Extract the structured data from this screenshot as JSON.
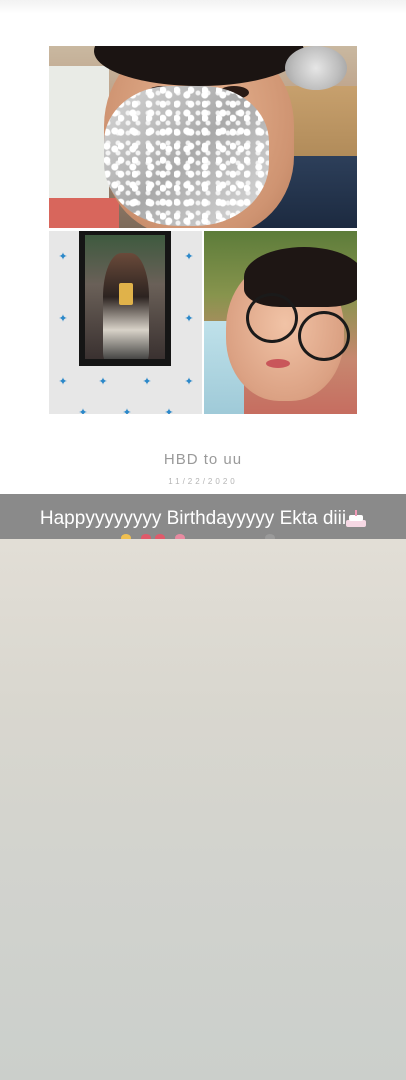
{
  "post": {
    "caption": "HBD to uu",
    "date": "11/22/2020"
  },
  "overlay": {
    "banner_text": "Happyyyyyyyy Birthdayyyyy Ekta diii",
    "banner_emoji": "birthday-cake-icon"
  },
  "colors": {
    "banner_bg": "#808080",
    "caption_text": "#9a9a9a",
    "butterfly": "#2b88c9"
  }
}
